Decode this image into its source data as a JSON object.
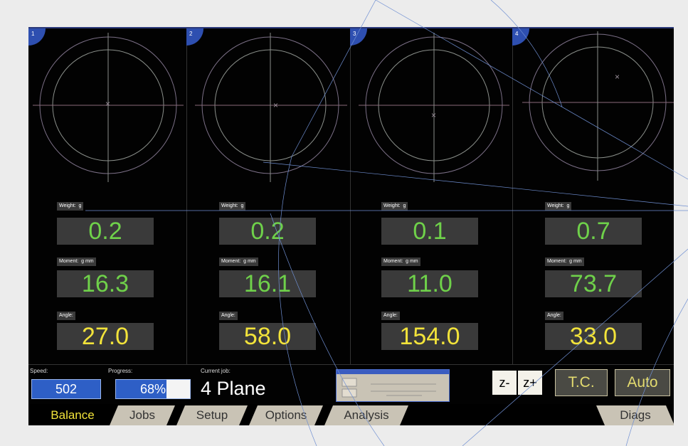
{
  "panels": [
    {
      "number": "1",
      "weight_label": "Weight:",
      "weight_unit": "g",
      "weight": "0.2",
      "moment_label": "Moment:",
      "moment_unit": "g mm",
      "moment": "16.3",
      "angle_label": "Angle:",
      "angle": "27.0"
    },
    {
      "number": "2",
      "weight_label": "Weight:",
      "weight_unit": "g",
      "weight": "0.2",
      "moment_label": "Moment:",
      "moment_unit": "g mm",
      "moment": "16.1",
      "angle_label": "Angle:",
      "angle": "58.0"
    },
    {
      "number": "3",
      "weight_label": "Weight:",
      "weight_unit": "g",
      "weight": "0.1",
      "moment_label": "Moment:",
      "moment_unit": "g mm",
      "moment": "11.0",
      "angle_label": "Angle:",
      "angle": "154.0"
    },
    {
      "number": "4",
      "weight_label": "Weight:",
      "weight_unit": "g",
      "weight": "0.7",
      "moment_label": "Moment:",
      "moment_unit": "g mm",
      "moment": "73.7",
      "angle_label": "Angle:",
      "angle": "33.0"
    }
  ],
  "status": {
    "speed_label": "Speed:",
    "speed": "502",
    "progress_label": "Progress:",
    "progress": "68%",
    "progress_fraction": 0.68,
    "job_label": "Current job:",
    "job": "4 Plane"
  },
  "buttons": {
    "z_minus": "z-",
    "z_plus": "z+",
    "tc": "T.C.",
    "auto": "Auto"
  },
  "tabs": {
    "balance": "Balance",
    "jobs": "Jobs",
    "setup": "Setup",
    "options": "Options",
    "analysis": "Analysis",
    "diags": "Diags"
  },
  "colors": {
    "value_green": "#6fd14a",
    "value_yellow": "#f2e33a",
    "accent_blue": "#2e5fc6",
    "tab_beige": "#c9c3b5"
  }
}
